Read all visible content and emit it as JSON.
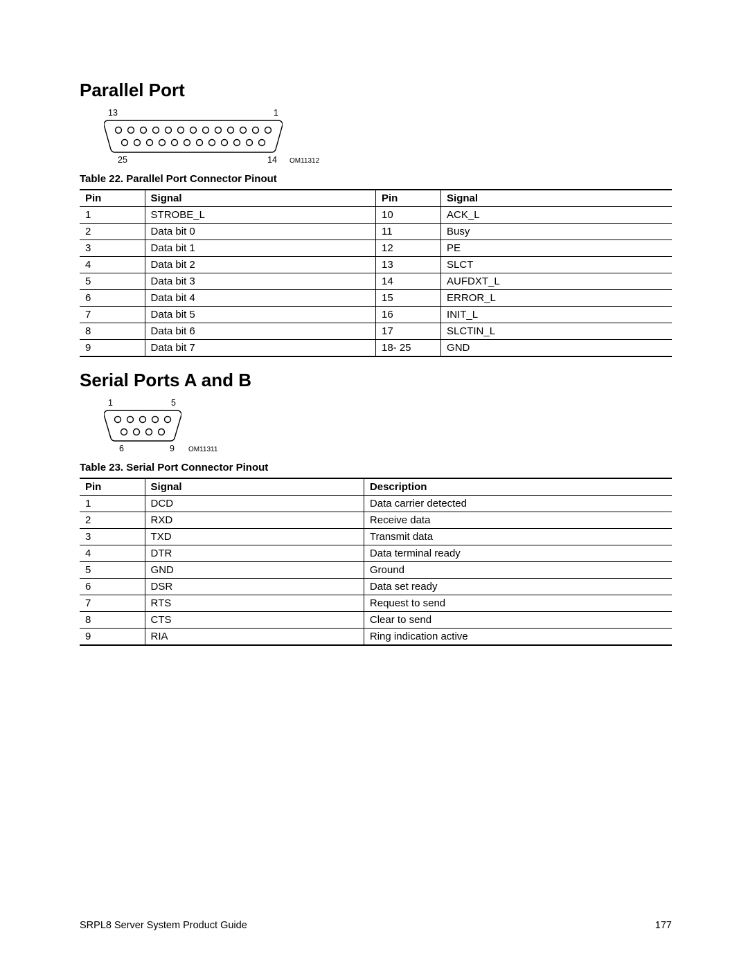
{
  "section1": {
    "heading": "Parallel Port",
    "connector": {
      "top_left": "13",
      "top_right": "1",
      "bottom_left": "25",
      "bottom_right": "14",
      "fig_id": "OM11312"
    },
    "table_caption": "Table 22.    Parallel Port Connector Pinout",
    "columns": [
      "Pin",
      "Signal",
      "Pin",
      "Signal"
    ],
    "rows": [
      [
        "1",
        "STROBE_L",
        "10",
        "ACK_L"
      ],
      [
        "2",
        "Data bit 0",
        "11",
        "Busy"
      ],
      [
        "3",
        "Data bit 1",
        "12",
        "PE"
      ],
      [
        "4",
        "Data bit 2",
        "13",
        "SLCT"
      ],
      [
        "5",
        "Data bit 3",
        "14",
        "AUFDXT_L"
      ],
      [
        "6",
        "Data bit 4",
        "15",
        "ERROR_L"
      ],
      [
        "7",
        "Data bit 5",
        "16",
        "INIT_L"
      ],
      [
        "8",
        "Data bit 6",
        "17",
        "SLCTIN_L"
      ],
      [
        "9",
        "Data bit 7",
        "18- 25",
        "GND"
      ]
    ]
  },
  "section2": {
    "heading": "Serial Ports A and B",
    "connector": {
      "top_left": "1",
      "top_right": "5",
      "bottom_left": "6",
      "bottom_right": "9",
      "fig_id": "OM11311"
    },
    "table_caption": "Table 23.    Serial Port Connector Pinout",
    "columns": [
      "Pin",
      "Signal",
      "Description"
    ],
    "rows": [
      [
        "1",
        "DCD",
        "Data carrier detected"
      ],
      [
        "2",
        "RXD",
        "Receive data"
      ],
      [
        "3",
        "TXD",
        "Transmit data"
      ],
      [
        "4",
        "DTR",
        "Data terminal ready"
      ],
      [
        "5",
        "GND",
        "Ground"
      ],
      [
        "6",
        "DSR",
        "Data set ready"
      ],
      [
        "7",
        "RTS",
        "Request to send"
      ],
      [
        "8",
        "CTS",
        "Clear to send"
      ],
      [
        "9",
        "RIA",
        "Ring indication active"
      ]
    ]
  },
  "footer": {
    "left": "SRPL8 Server System Product Guide",
    "right": "177"
  }
}
